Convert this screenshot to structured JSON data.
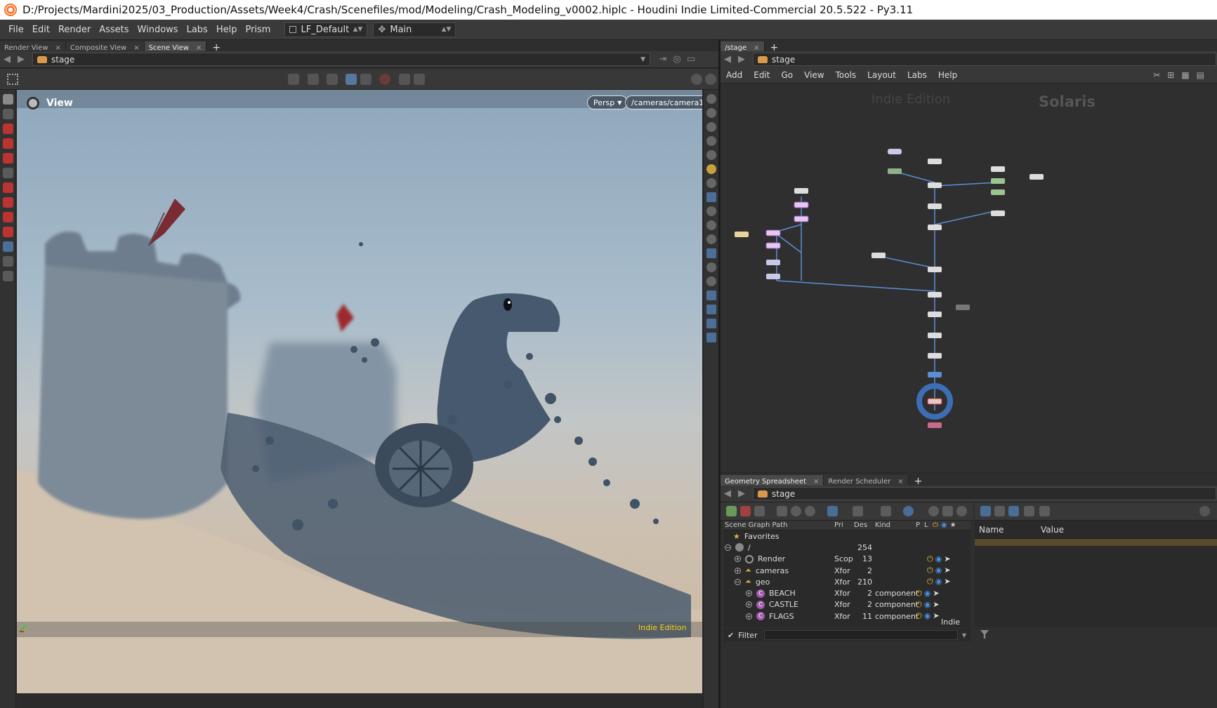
{
  "titlebar": {
    "title": "D:/Projects/Mardini2025/03_Production/Assets/Week4/Crash/Scenefiles/mod/Modeling/Crash_Modeling_v0002.hiplc - Houdini Indie Limited-Commercial 20.5.522 - Py3.11"
  },
  "menubar": {
    "items": [
      "File",
      "Edit",
      "Render",
      "Assets",
      "Windows",
      "Labs",
      "Help",
      "Prism"
    ],
    "desktop": "LF_Default",
    "context": "Main"
  },
  "left_pane": {
    "tabs": [
      "Render View",
      "Composite View",
      "Scene View"
    ],
    "active_tab": "Scene View",
    "path": "stage",
    "view_label": "View",
    "persp_label": "Persp",
    "camera_label": "/cameras/camera1",
    "indie_badge": "Indie Edition"
  },
  "network_pane": {
    "tab": "/stage",
    "path": "stage",
    "menu": [
      "Add",
      "Edit",
      "Go",
      "View",
      "Tools",
      "Layout",
      "Labs",
      "Help"
    ],
    "watermark": "Indie Edition",
    "context_label": "Solaris"
  },
  "sheet_pane": {
    "tabs": [
      "Geometry Spreadsheet",
      "Render Scheduler"
    ],
    "path": "stage",
    "columns": [
      "Scene Graph Path",
      "Pri",
      "Des",
      "Kind",
      "P",
      "L"
    ],
    "rows": [
      {
        "name": "Favorites",
        "pri": "",
        "des": "",
        "kind": ""
      },
      {
        "name": "/",
        "pri": "",
        "des": "254",
        "kind": ""
      },
      {
        "name": "Render",
        "pri": "Scop",
        "des": "13",
        "kind": ""
      },
      {
        "name": "cameras",
        "pri": "Xfor",
        "des": "2",
        "kind": ""
      },
      {
        "name": "geo",
        "pri": "Xfor",
        "des": "210",
        "kind": ""
      },
      {
        "name": "BEACH",
        "pri": "Xfor",
        "des": "2",
        "kind": "component"
      },
      {
        "name": "CASTLE",
        "pri": "Xfor",
        "des": "2",
        "kind": "component"
      },
      {
        "name": "FLAGS",
        "pri": "Xfor",
        "des": "11",
        "kind": "component"
      }
    ],
    "props_columns": [
      "Name",
      "Value"
    ],
    "filter_label": "Filter",
    "indie_badge": "Indie"
  },
  "colors": {
    "accent": "#4a6d96",
    "indie_yellow": "#f2d21c",
    "node_purple": "#8a5cc4",
    "wire_blue": "#5a8fd6"
  }
}
